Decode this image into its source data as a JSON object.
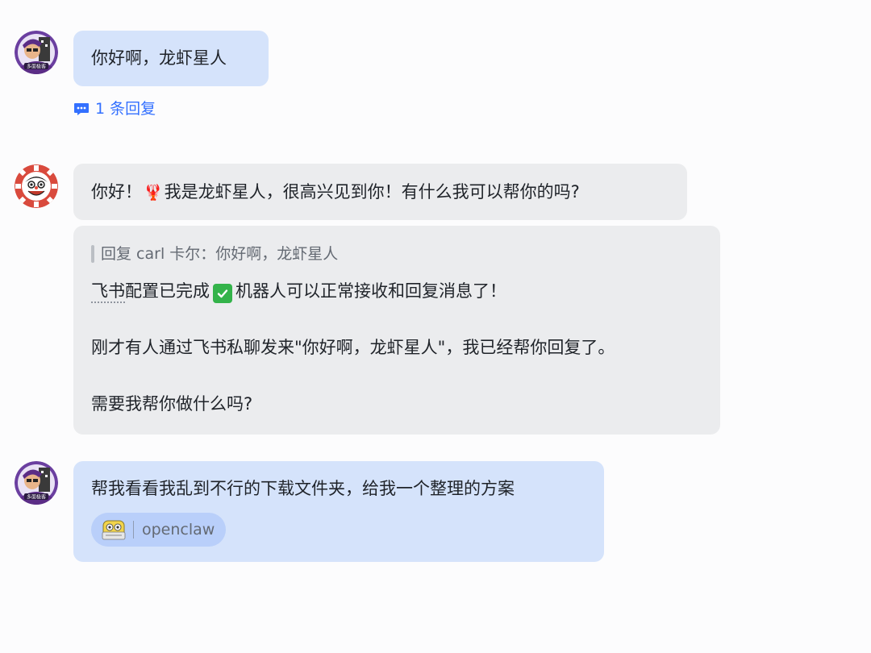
{
  "messages": [
    {
      "sender": "user",
      "text": "你好啊，龙虾星人",
      "avatar_icon": "user-avatar-icon",
      "reply_count_label": "1 条回复"
    },
    {
      "sender": "bot",
      "text_before": "你好！",
      "emoji": "🦞",
      "text_after": "我是龙虾星人，很高兴见到你！有什么我可以帮你的吗?",
      "avatar_icon": "bot-avatar-icon"
    },
    {
      "sender": "bot",
      "quote": "回复 carl 卡尔：你好啊，龙虾星人",
      "line1_prefix": "飞书",
      "line1_mid": "配置已完成",
      "line1_suffix": "机器人可以正常接收和回复消息了！",
      "line2": "刚才有人通过飞书私聊发来\"你好啊，龙虾星人\"，我已经帮你回复了。",
      "line3": "需要我帮你做什么吗?"
    },
    {
      "sender": "user",
      "text": "帮我看看我乱到不行的下载文件夹，给我一个整理的方案",
      "avatar_icon": "user-avatar-icon",
      "mention_label": "openclaw"
    }
  ],
  "colors": {
    "user_bubble": "#d5e3fb",
    "bot_bubble": "#ebecee",
    "link_blue": "#3370ff",
    "check_green": "#33b34a"
  }
}
